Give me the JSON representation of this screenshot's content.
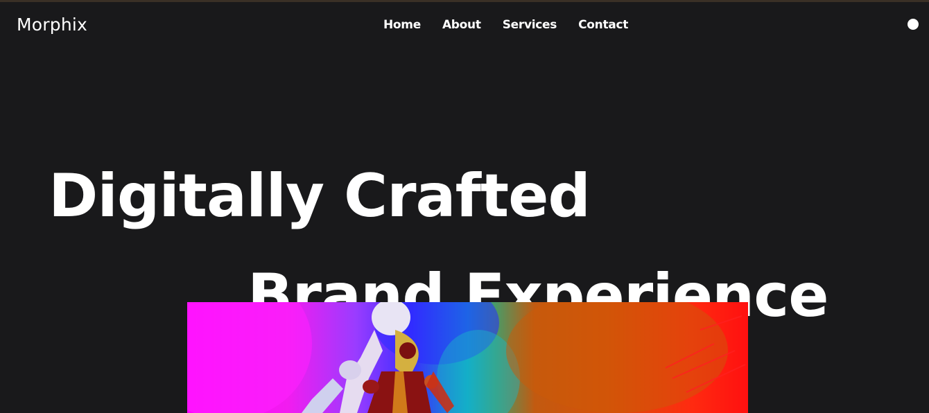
{
  "brand": {
    "logo_text": "Morphix"
  },
  "nav": {
    "links": [
      "Home",
      "About",
      "Services",
      "Contact"
    ]
  },
  "menu_toggle": {
    "icon": "menu-dot-icon"
  },
  "hero": {
    "line1": "Digitally Crafted",
    "line2": "Brand Experience",
    "media": {
      "icon": "hero-artwork-image"
    }
  },
  "colors": {
    "background": "#19191b",
    "text": "#ffffff",
    "top_border": "#3a3026"
  }
}
